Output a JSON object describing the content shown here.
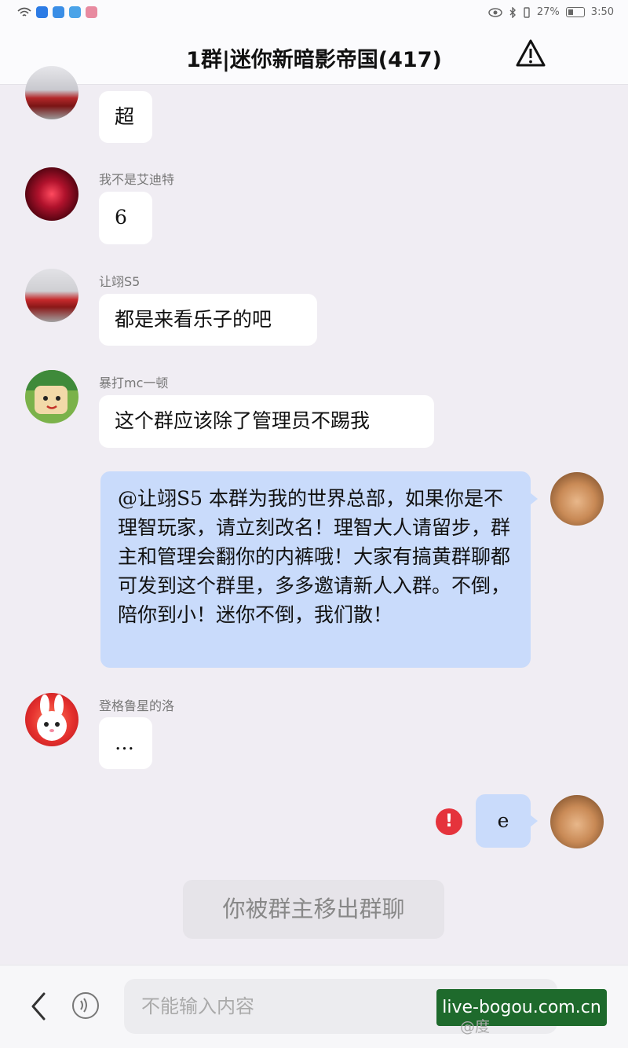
{
  "status_bar": {
    "battery": "27%",
    "time": "3:50"
  },
  "header": {
    "title": "1群|迷你新暗影帝国(417)"
  },
  "messages": [
    {
      "sender": "",
      "text": "超"
    },
    {
      "sender": "我不是艾迪特",
      "text": "6"
    },
    {
      "sender": "让翊S5",
      "text": "都是来看乐子的吧"
    },
    {
      "sender": "暴打mc一顿",
      "text": "这个群应该除了管理员不踢我"
    },
    {
      "sender": "",
      "text": "@让翊S5 本群为我的世界总部，如果你是不理智玩家，请立刻改名！理智大人请留步，群主和管理会翻你的内裤哦！大家有搞黄群聊都可发到这个群里，多多邀请新人入群。不倒，陪你到小！迷你不倒，我们散！"
    },
    {
      "sender": "登格鲁星的洛",
      "text": "…"
    },
    {
      "sender": "",
      "text": "e"
    }
  ],
  "error_badge": "!",
  "system_notice": "你被群主移出群聊",
  "input": {
    "placeholder": "不能输入内容"
  },
  "watermark": {
    "site": "live-bogou.com.cn",
    "caption": "@度"
  },
  "colors": {
    "my_bubble": "#c9dbfb",
    "error": "#e5333c",
    "watermark_bg": "#1e6a2c"
  }
}
